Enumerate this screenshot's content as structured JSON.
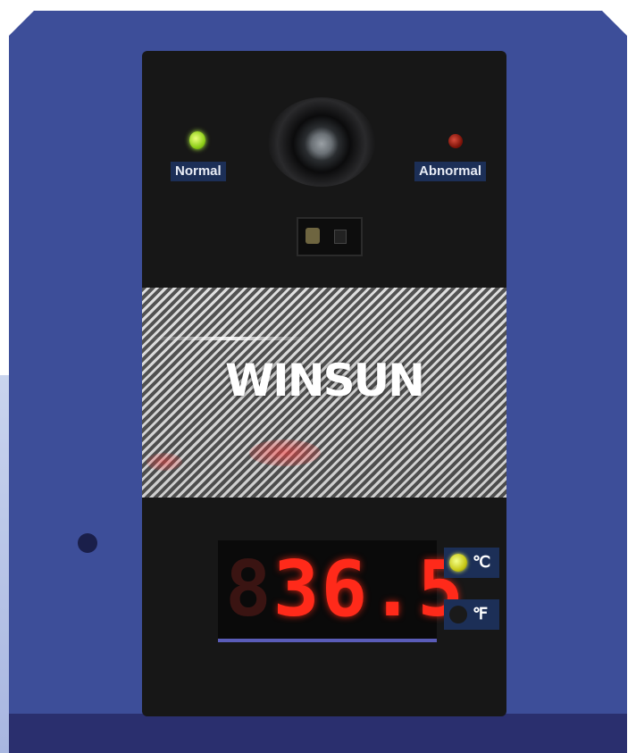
{
  "indicators": {
    "normal_label": "Normal",
    "abnormal_label": "Abnormal"
  },
  "brand": {
    "logo_text": "WINSUN"
  },
  "temperature": {
    "reading": "36.5",
    "leading_digit_off": "8"
  },
  "units": {
    "celsius_label": "℃",
    "fahrenheit_label": "℉",
    "active_unit": "celsius"
  },
  "colors": {
    "housing": "#3d4e99",
    "normal_led": "#8fcf1a",
    "abnormal_led": "#7a1208",
    "display_digits": "#ff2a1a"
  }
}
